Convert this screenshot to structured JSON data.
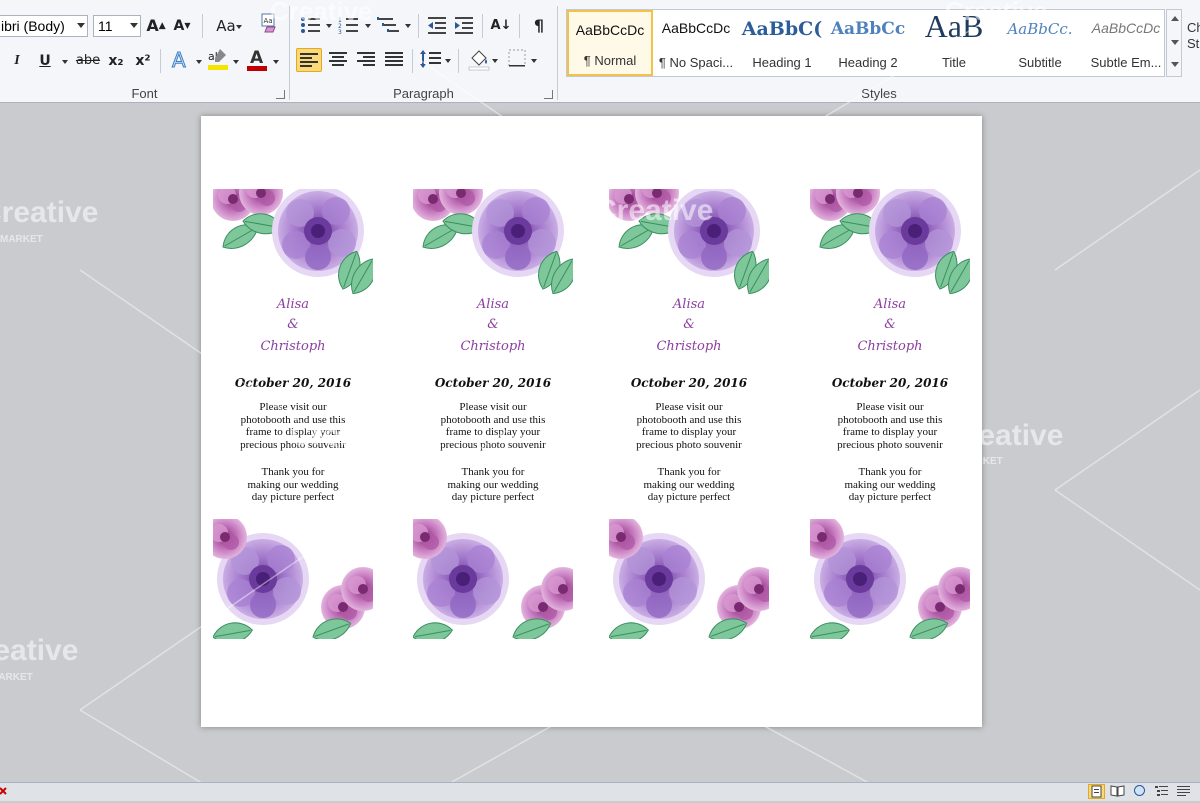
{
  "ribbon": {
    "font": {
      "font_name": "ibri (Body)",
      "font_size": "11",
      "grow_label": "A",
      "shrink_label": "A",
      "change_case_label": "Aa",
      "italic_label": "I",
      "underline_label": "U",
      "strike_label": "abe",
      "subscript_label": "x₂",
      "superscript_label": "x²",
      "highlight_label": "ab",
      "font_color_label": "A",
      "group_label": "Font"
    },
    "paragraph": {
      "sort_label": "A↓",
      "pilcrow_label": "¶",
      "group_label": "Paragraph"
    },
    "styles": {
      "items": [
        {
          "sample": "AaBbCcDc",
          "name": "¶ Normal",
          "selected": true
        },
        {
          "sample": "AaBbCcDc",
          "name": "¶ No Spaci...",
          "selected": false
        },
        {
          "sample": "AaBbC(",
          "name": "Heading 1",
          "selected": false
        },
        {
          "sample": "AaBbCc",
          "name": "Heading 2",
          "selected": false
        },
        {
          "sample": "AaB",
          "name": "Title",
          "selected": false
        },
        {
          "sample": "AaBbCc.",
          "name": "Subtitle",
          "selected": false
        },
        {
          "sample": "AaBbCcDc",
          "name": "Subtle Em...",
          "selected": false
        }
      ],
      "group_label": "Styles",
      "change_styles_label": "Ch St"
    }
  },
  "document": {
    "cards": [
      {
        "name1": "Alisa",
        "amp": "&",
        "name2": "Christoph",
        "date": "October 20, 2016",
        "para1": [
          "Please visit our",
          "photobooth and use this",
          "frame to display your",
          "precious photo souvenir"
        ],
        "para2": [
          "Thank you for",
          "making our wedding",
          "day picture perfect"
        ]
      },
      {
        "name1": "Alisa",
        "amp": "&",
        "name2": "Christoph",
        "date": "October 20, 2016",
        "para1": [
          "Please visit our",
          "photobooth and use this",
          "frame to display your",
          "precious photo souvenir"
        ],
        "para2": [
          "Thank you for",
          "making our wedding",
          "day picture perfect"
        ]
      },
      {
        "name1": "Alisa",
        "amp": "&",
        "name2": "Christoph",
        "date": "October 20, 2016",
        "para1": [
          "Please visit our",
          "photobooth and use this",
          "frame to display your",
          "precious photo souvenir"
        ],
        "para2": [
          "Thank you for",
          "making our wedding",
          "day picture perfect"
        ]
      },
      {
        "name1": "Alisa",
        "amp": "&",
        "name2": "Christoph",
        "date": "October 20, 2016",
        "para1": [
          "Please visit our",
          "photobooth and use this",
          "frame to display your",
          "precious photo souvenir"
        ],
        "para2": [
          "Thank you for",
          "making our wedding",
          "day picture perfect"
        ]
      }
    ]
  },
  "watermark": {
    "brand": "Creative",
    "sub": "MARKET"
  },
  "colors": {
    "accent_purple": "#8c3fa0",
    "flower_purple": "#9b6cc6",
    "flower_pink": "#c77bc0",
    "leaf_green": "#4aa574",
    "highlight_yellow": "#f2e600",
    "font_color_red": "#c00000"
  }
}
